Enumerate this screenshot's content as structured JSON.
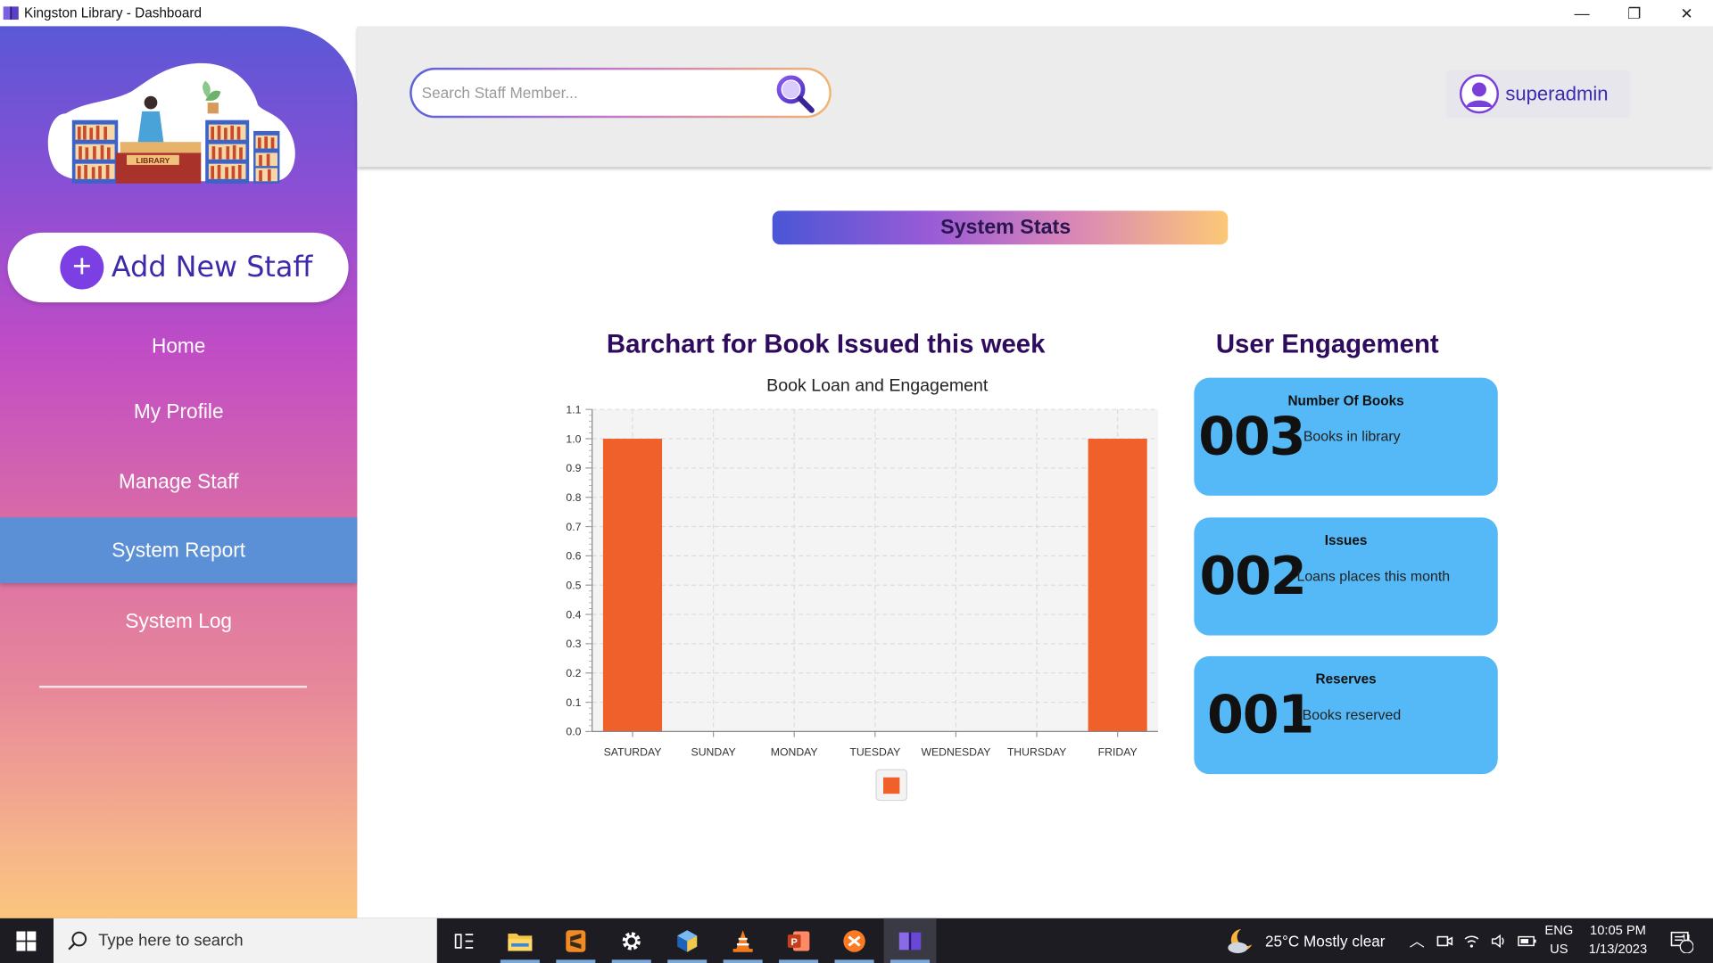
{
  "window": {
    "title": "Kingston Library -  Dashboard",
    "controls": {
      "minimize": "—",
      "maximize": "❐",
      "close": "✕"
    }
  },
  "sidebar": {
    "logo_text": "LIBRARY",
    "add_staff_label": "Add New Staff",
    "items": [
      {
        "label": "Home",
        "active": false
      },
      {
        "label": "My Profile",
        "active": false
      },
      {
        "label": "Manage Staff",
        "active": false
      },
      {
        "label": "System Report",
        "active": true
      },
      {
        "label": "System Log",
        "active": false
      }
    ]
  },
  "header": {
    "search_placeholder": "Search Staff Member...",
    "username": "superadmin"
  },
  "main": {
    "banner": "System Stats",
    "chart_heading": "Barchart for Book Issued this week",
    "engagement_heading": "User Engagement",
    "cards": [
      {
        "title": "Number Of Books",
        "number": "003",
        "desc": "Books in library"
      },
      {
        "title": "Issues",
        "number": "002",
        "desc": "Loans places this month"
      },
      {
        "title": "Reserves",
        "number": "001",
        "desc": "Books reserved"
      }
    ]
  },
  "chart_data": {
    "type": "bar",
    "title": "Book Loan and Engagement",
    "xlabel": "",
    "ylabel": "",
    "categories": [
      "SATURDAY",
      "SUNDAY",
      "MONDAY",
      "TUESDAY",
      "WEDNESDAY",
      "THURSDAY",
      "FRIDAY"
    ],
    "values": [
      1.0,
      0,
      0,
      0,
      0,
      0,
      1.0
    ],
    "ylim": [
      0,
      1.1
    ],
    "yticks": [
      "0.0",
      "0.1",
      "0.2",
      "0.3",
      "0.4",
      "0.5",
      "0.6",
      "0.7",
      "0.8",
      "0.9",
      "1.0",
      "1.1"
    ],
    "grid": true,
    "legend": "bottom",
    "bar_color": "#f0602b"
  },
  "taskbar": {
    "search_text": "Type here to search",
    "weather": "25°C  Mostly clear",
    "lang_top": "ENG",
    "lang_bottom": "US",
    "time": "10:05 PM",
    "date": "1/13/2023",
    "notification_count": "11"
  }
}
